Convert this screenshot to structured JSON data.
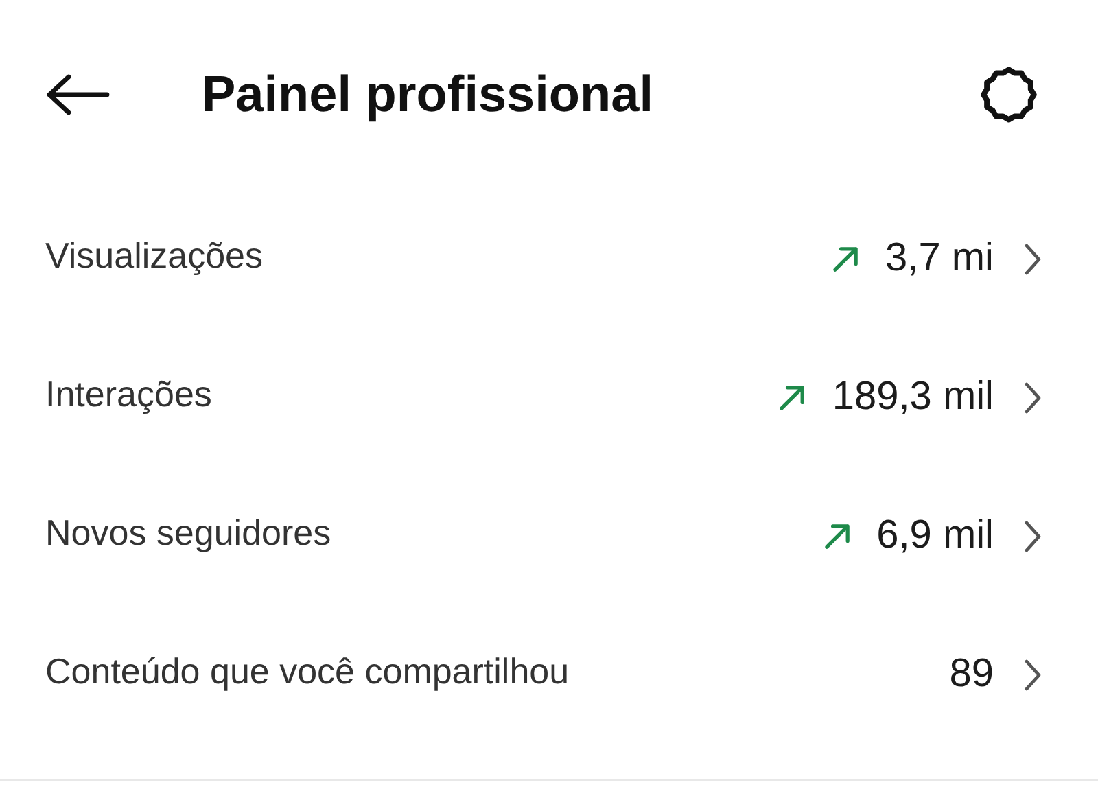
{
  "header": {
    "title": "Painel profissional"
  },
  "metrics": [
    {
      "kind": "rising",
      "label": "Visualizações",
      "value": "3,7 mi"
    },
    {
      "kind": "rising",
      "label": "Interações",
      "value": "189,3 mil"
    },
    {
      "kind": "rising",
      "label": "Novos seguidores",
      "value": "6,9 mil"
    },
    {
      "kind": "plain",
      "label": "Conteúdo que você compartilhou",
      "value": "89"
    }
  ]
}
